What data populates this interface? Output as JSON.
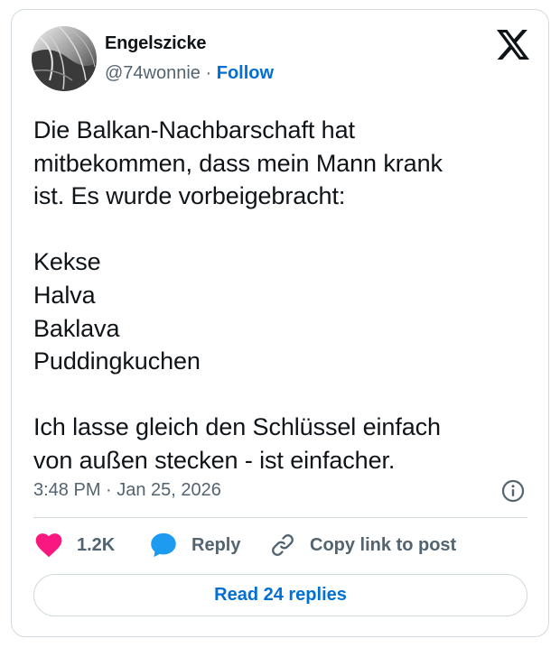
{
  "author": {
    "display_name": "Engelszicke",
    "handle": "@74wonnie",
    "separator": "·",
    "follow_label": "Follow",
    "avatar_icon": "avatar-photo"
  },
  "header": {
    "logo_icon": "x-logo-icon"
  },
  "tweet": {
    "text": "Die Balkan-Nachbarschaft hat\nmitbekommen, dass mein Mann krank\nist. Es wurde vorbeigebracht:\n\nKekse\nHalva\nBaklava\nPuddingkuchen\n\nIch lasse gleich den Schlüssel einfach\nvon außen stecken - ist einfacher.",
    "timestamp": "3:48 PM · Jan 25, 2026",
    "info_icon": "info-icon"
  },
  "actions": {
    "like_count": "1.2K",
    "reply_label": "Reply",
    "copy_label": "Copy link to post",
    "read_replies_label": "Read 24 replies"
  },
  "colors": {
    "accent": "#006fd6",
    "like": "#f91880",
    "reply": "#1d9bf0",
    "text": "#0f1419",
    "secondary": "#536471",
    "border": "#cfd9de"
  }
}
